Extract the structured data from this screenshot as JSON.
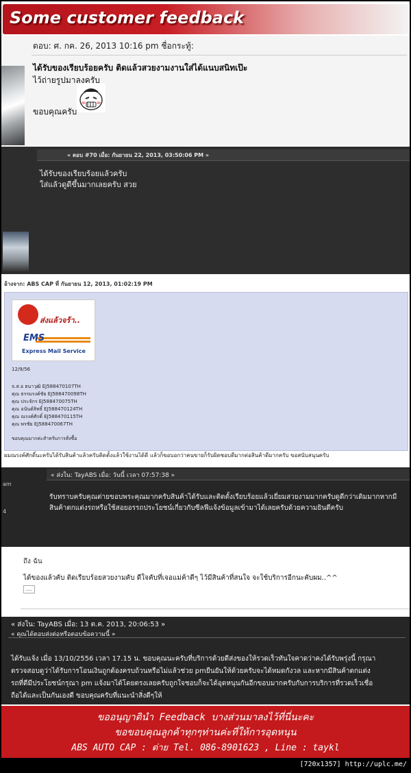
{
  "header": {
    "title": "Some customer feedback"
  },
  "post1": {
    "meta": "ตอบ: ศ. กค. 26, 2013 10:16 pm    ชื่อกระทู้:",
    "line1": "ได้รับของเรียบร้อยครับ ติดแล้วสวยงามงานใส่ได้แนบสนิทเป๊ะ",
    "line2": "ไว้ถ่ายรูปมาลงครับ",
    "line3": "ขอบคุณครับ"
  },
  "post2": {
    "meta": "« ตอบ #70 เมื่อ: กันยายน 22, 2013, 03:50:06 PM »",
    "line1": "ได้รับของเรียบร้อยแล้วครับ",
    "line2": "ใส่แล้วดูดีขึ้นมากเลยครับ สวย"
  },
  "post3": {
    "meta": "อ้างจาก: ABS CAP ที่ กันยายน 12, 2013, 01:02:19 PM",
    "ems_caption": "ส่งแล้วจร้า..",
    "ems_logo": "EMS",
    "ems_sub": "Express Mail Service",
    "date": "12/9/56",
    "tracking": [
      "จ.ส.อ ธนาวุฒิ EJ588470107TH",
      "คุณ ธรรมรงค์ชัย EJ588470098TH",
      "คุณ ประจักร EJ588470075TH",
      "คุณ อนันต์สิทธิ์ EJ588470124TH",
      "คุณ ณรงค์ศักดิ์ EJ588470115TH",
      "คุณ พรชัย EJ588470067TH"
    ],
    "thanks": "ขอบคุณมากค่ะสำหรับการสั่งซื้อ",
    "reply": "ผมณรงค์ศักดิ์นะครับได้รับสินค้าแล้วครับติดตั้งแล้วใช้งานได้ดี แล้วก็ขอบอกว่าคนขายก็รับผิดชอบดีมากต่อสินค้าดีมากครับ ขอสนับสนุนครับ"
  },
  "post4": {
    "meta": "« ส่งใน: TayABS เมื่อ: วันนี้ เวลา 07:57:38 »",
    "side1": "am",
    "side2": "4",
    "text": "รับทราบครับคุณต่ายขอบพระคุณมากครับสินค้าได้รับและติดตั้งเรียบร้อยแล้วเยี่ยมสวยงามมากครับดูดีกว่าเดิมมากหากมีสินค้าตกแต่งรถหรือใช้สอยอรรถประโยชน์เกี่ยวกับซีลฟีแจ้งข้อมูลเข้ามาได้เลยครับด้วยความยินดีครับ"
  },
  "post5": {
    "name": "ถึง ฉัน",
    "text": "ได้ของแล้วคับ ติดเรียบร้อยสวยงามคับ ดีใจคับที่เจอแม่ค้าดีๆ ไว้มีสินค้าที่สนใจ จะใช้บริการอีกนะคับผม..^^",
    "more": "..."
  },
  "post6": {
    "meta1": "« ส่งใน: TayABS เมื่อ: 13 ต.ค. 2013, 20:06:53 »",
    "meta2": "« คุณได้ตอบส่งต่อหรือตอบข้อความนี้ »",
    "lines": [
      "ได้รับแจ้ง เมื่อ 13/10/2556 เวลา 17.15 น. ขอบคุณนะครับที่บริการด้วยดีส่งของให้รวดเร็วทันใจคาดว่าคงได้รับพรุ่งนี้ กรุณา",
      "ตรวจสอบดูว่าได้รับการโอนเงินถูกต้องครบถ้วนหรือไม่แล้วช่วย pmยืนยันให้ด้วยครับจะได้หมดกังวล และหากมีสินค้าตกแต่ง",
      "รถที่ดีมีประโยชน์กรุณา pm แจ้งมาได้โดยตรงเลยครับถูกใจชอบก็จะได้อุดหนุนกันอีกขอบมากครับกับการบริการที่รวดเร็วเชื่อ",
      "ถือได้และเป็นกันเองดี ขอบคุณครับที่แนะนำสิ่งดีๆให้"
    ]
  },
  "footer": {
    "line1": "ขออนุญาตินำ Feedback บางส่วนมาลงไว้ที่นี่นะคะ",
    "line2": "ขอขอบคุณลูกค้าทุกๆท่านค่ะที่ให้การอุดหนุน",
    "line3": "ABS AUTO CAP : ต่าย Tel. 086-8901623 , Line : taykl"
  },
  "watermark": "[720x1357] http://uplc.me/"
}
